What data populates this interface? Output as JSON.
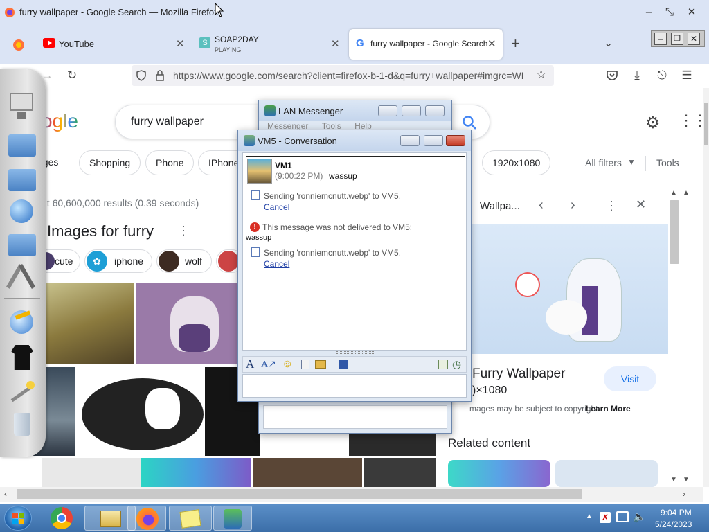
{
  "window": {
    "title": "furry wallpaper - Google Search — Mozilla Firefox"
  },
  "tabs": [
    {
      "label": "YouTube"
    },
    {
      "label": "SOAP2DAY",
      "sublabel": "PLAYING"
    },
    {
      "label": "furry wallpaper - Google Search",
      "active": true
    }
  ],
  "navbar": {
    "url": "https://www.google.com/search?client=firefox-b-1-d&q=furry+wallpaper#imgrc=WI"
  },
  "google": {
    "logo": "ogle",
    "query": "furry wallpaper",
    "filters": [
      "ages",
      "Shopping",
      "Phone",
      "IPhone",
      "1920x1080"
    ],
    "all_filters": "All filters",
    "tools": "Tools",
    "results_count": "ut 60,600,000 results (0.39 seconds)",
    "images_heading": "Images for furry",
    "related_chips": [
      "cute",
      "iphone",
      "wolf"
    ]
  },
  "side_panel": {
    "title": "Wallpa...",
    "heading": "Furry Wallpaper",
    "resolution": ")×1080",
    "visit": "Visit",
    "copyright": "mages may be subject to copyright.",
    "learn_more": "Learn More",
    "related": "Related content"
  },
  "lan_messenger": {
    "title": "LAN Messenger",
    "menu": [
      "Messenger",
      "Tools",
      "Help"
    ]
  },
  "conversation": {
    "title": "VM5 - Conversation",
    "user": "VM1",
    "time": "(9:00:22 PM)",
    "user_message": "wassup",
    "sending_1": "Sending 'ronniemcnutt.webp' to VM5.",
    "cancel_1": "Cancel",
    "error": "This message was not delivered to VM5:",
    "error_body": "wassup",
    "sending_2": "Sending 'ronniemcnutt.webp' to VM5.",
    "cancel_2": "Cancel"
  },
  "taskbar": {
    "time": "9:04 PM",
    "date": "5/24/2023"
  },
  "colors": {
    "google_blue": "#4285f4",
    "firefox_tab_bg": "#dbe4f5",
    "taskbar": "#3b6ea8",
    "error_red": "#d93025"
  }
}
